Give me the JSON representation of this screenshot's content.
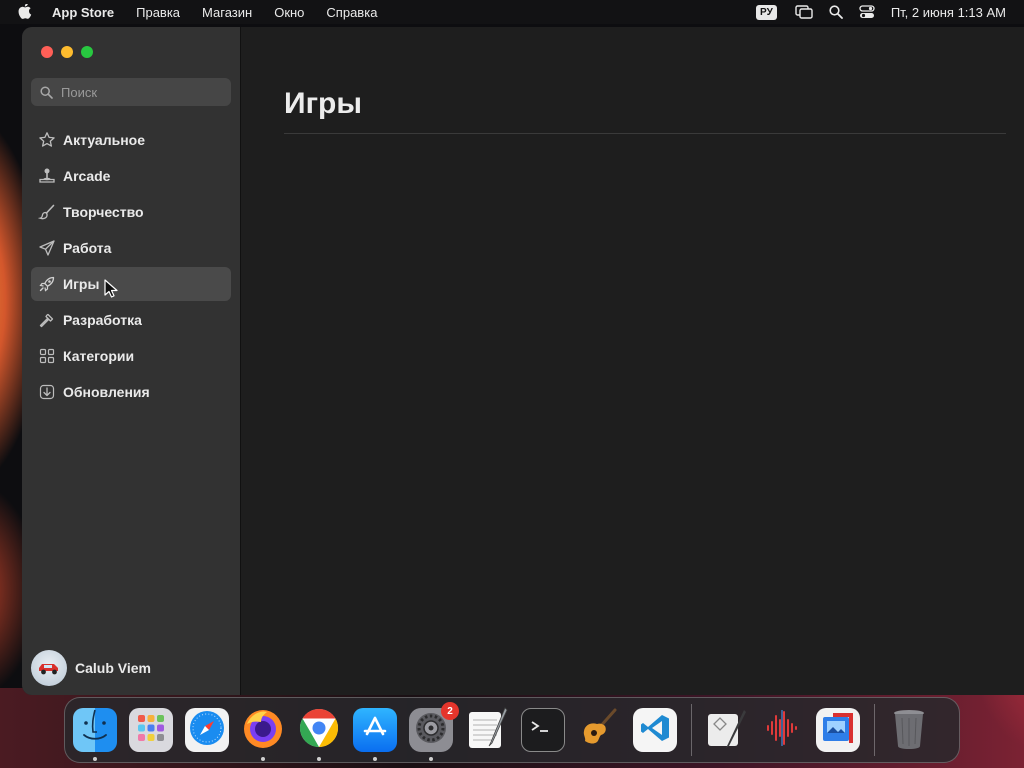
{
  "menubar": {
    "app_name": "App Store",
    "menus": [
      "Правка",
      "Магазин",
      "Окно",
      "Справка"
    ],
    "input_language": "РУ",
    "clock": "Пт, 2 июня  1:13 AM"
  },
  "window": {
    "search_placeholder": "Поиск",
    "nav": [
      {
        "label": "Актуальное",
        "icon": "star-icon"
      },
      {
        "label": "Arcade",
        "icon": "joystick-icon"
      },
      {
        "label": "Творчество",
        "icon": "brush-icon"
      },
      {
        "label": "Работа",
        "icon": "paper-plane-icon"
      },
      {
        "label": "Игры",
        "icon": "rocket-icon",
        "active": true
      },
      {
        "label": "Разработка",
        "icon": "hammer-icon"
      },
      {
        "label": "Категории",
        "icon": "grid-icon"
      },
      {
        "label": "Обновления",
        "icon": "download-icon"
      }
    ],
    "user_name": "Calub Viem",
    "page_title": "Игры"
  },
  "dock": {
    "apps": [
      "Finder",
      "Launchpad",
      "Safari",
      "Firefox",
      "Chrome",
      "App Store",
      "System Settings",
      "TextEdit",
      "Terminal",
      "GarageBand",
      "Visual Studio Code",
      "Script Editor",
      "Audio Editor",
      "Preview",
      "Trash"
    ],
    "settings_badge": "2"
  },
  "colors": {
    "sidebar_bg": "#323232",
    "content_bg": "#1e1e1e",
    "active_item_bg": "#4a4a4a",
    "accent_blue": "#0a84ff"
  }
}
